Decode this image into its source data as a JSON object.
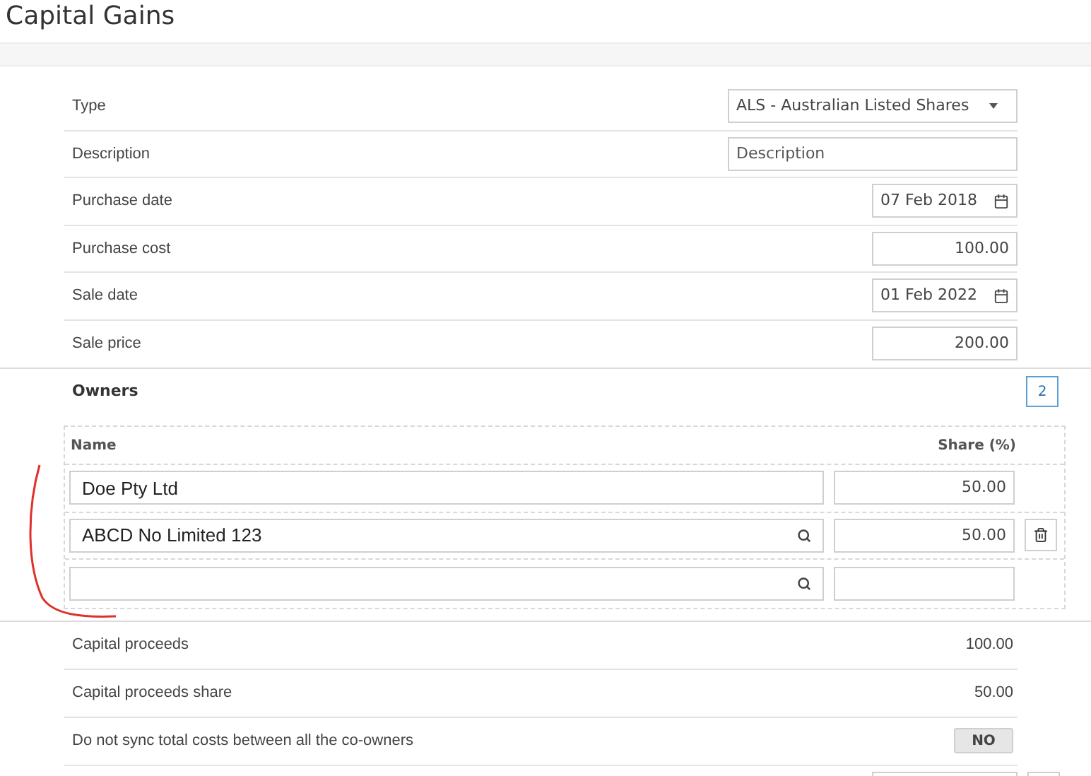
{
  "title": "Capital Gains",
  "fields": [
    {
      "label": "Type",
      "kind": "select",
      "value": "ALS - Australian Listed Shares"
    },
    {
      "label": "Description",
      "kind": "text",
      "placeholder": "Description"
    },
    {
      "label": "Purchase date",
      "kind": "date",
      "value": "07 Feb 2018"
    },
    {
      "label": "Purchase cost",
      "kind": "number",
      "value": "100.00"
    },
    {
      "label": "Sale date",
      "kind": "date",
      "value": "01 Feb 2022"
    },
    {
      "label": "Sale price",
      "kind": "number",
      "value": "200.00"
    }
  ],
  "owners": {
    "title": "Owners",
    "count": "2",
    "columns": [
      "Name",
      "Share (%)"
    ],
    "rows": [
      {
        "name": "Doe Pty Ltd",
        "share": "50.00",
        "searchable": false,
        "deletable": false
      },
      {
        "name": "ABCD No  Limited 123",
        "share": "50.00",
        "searchable": true,
        "deletable": true
      },
      {
        "name": "",
        "share": "",
        "searchable": true,
        "deletable": false
      }
    ]
  },
  "summary": [
    {
      "label": "Capital proceeds",
      "kind": "value",
      "value": "100.00"
    },
    {
      "label": "Capital proceeds share",
      "kind": "value",
      "value": "50.00"
    },
    {
      "label": "Do not sync total costs between all the co-owners",
      "kind": "toggle",
      "value": "NO"
    }
  ]
}
